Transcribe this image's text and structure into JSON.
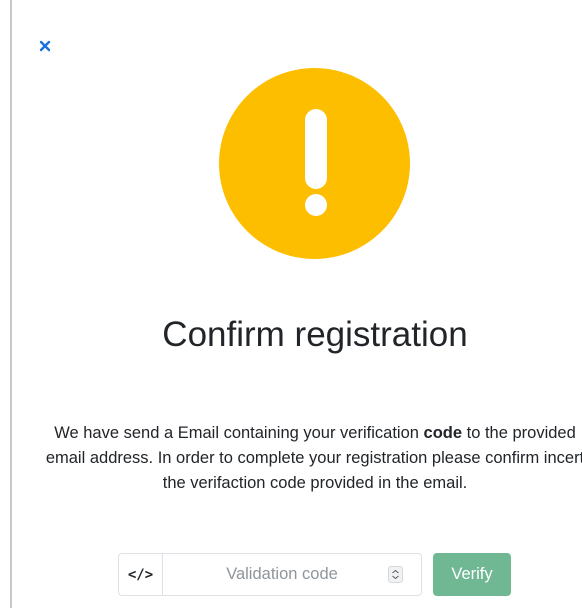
{
  "dialog": {
    "title": "Confirm registration",
    "message_before_bold": "We have send a Email containing your verification ",
    "message_bold": "code",
    "message_after_bold": " to the provided email address. In order to complete your registration please confirm incert the verifaction code provided in the email."
  },
  "form": {
    "addon_symbol": "</>",
    "code_placeholder": "Validation code",
    "code_value": "",
    "verify_label": "Verify"
  },
  "icons": {
    "close": "close-icon",
    "warning": "exclamation-icon",
    "code": "code-icon",
    "spinner": "number-spinner-icon"
  },
  "colors": {
    "close_icon": "#1a6fe0",
    "warning_circle": "#fdbe00",
    "verify_button": "#70b894"
  }
}
